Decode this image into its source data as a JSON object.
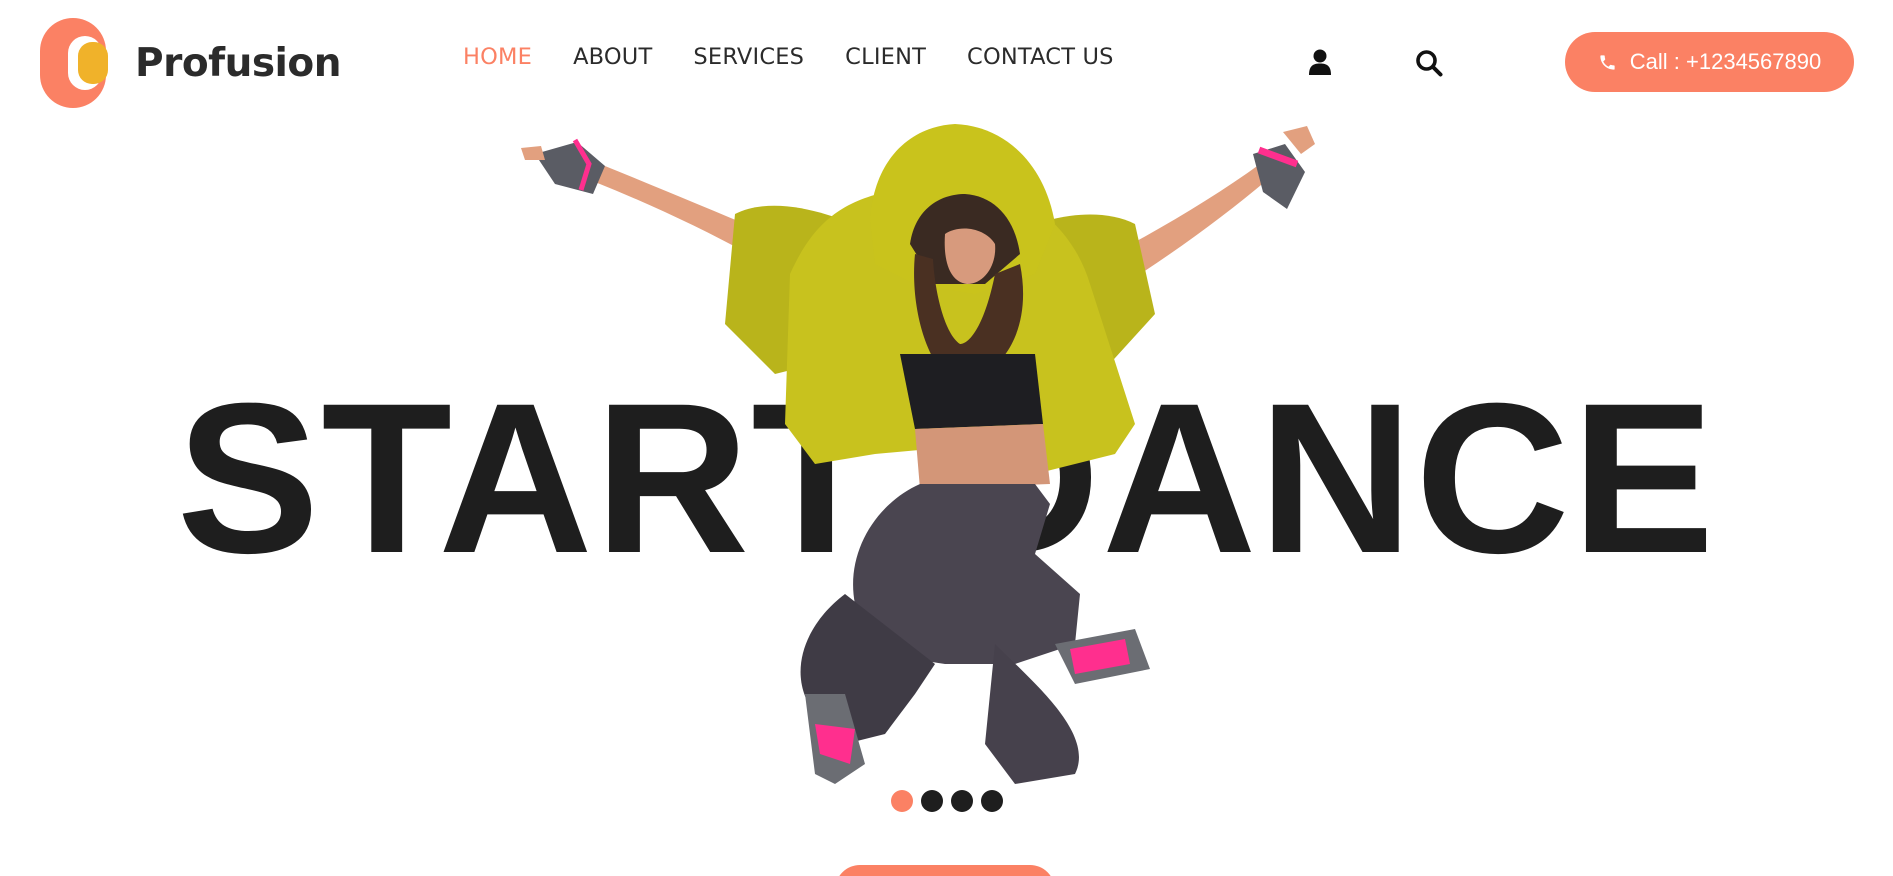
{
  "brand": {
    "name": "Profusion"
  },
  "nav": {
    "items": [
      {
        "label": "HOME",
        "active": true
      },
      {
        "label": "ABOUT",
        "active": false
      },
      {
        "label": "SERVICES",
        "active": false
      },
      {
        "label": "CLIENT",
        "active": false
      },
      {
        "label": "CONTACT US",
        "active": false
      }
    ]
  },
  "header_icons": [
    "user-icon",
    "search-icon"
  ],
  "call_button": {
    "label": "Call : +1234567890",
    "icon": "phone-icon"
  },
  "hero": {
    "title": "START DANCE",
    "slider": {
      "count": 4,
      "active_index": 0
    }
  },
  "colors": {
    "accent": "#fb8164",
    "gold": "#f0b22a",
    "text": "#2b2b2b",
    "title": "#1e1e1e"
  }
}
